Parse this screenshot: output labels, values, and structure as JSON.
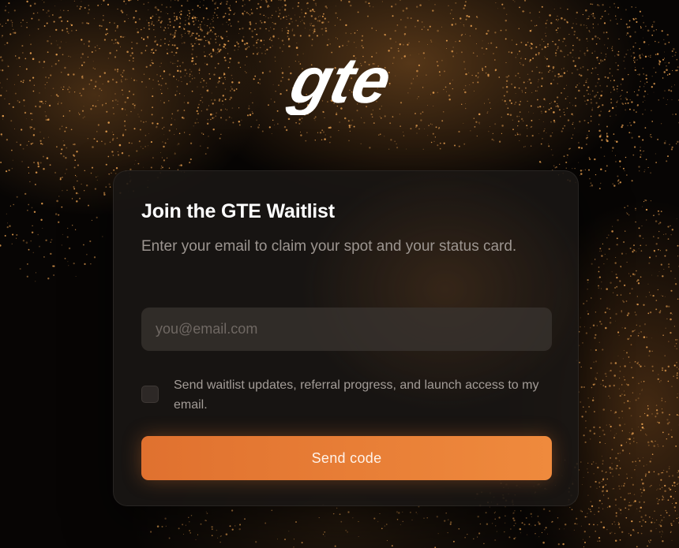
{
  "brand": {
    "logo_text": "gte"
  },
  "waitlist_card": {
    "title": "Join the GTE Waitlist",
    "subtitle": "Enter your email to claim your spot and your status card.",
    "email_field": {
      "placeholder": "you@email.com",
      "value": ""
    },
    "consent": {
      "checked": false,
      "label": "Send waitlist updates, referral progress, and launch access to my email."
    },
    "submit_label": "Send code"
  },
  "colors": {
    "accent": "#e8793a",
    "card_background": "#1a1614",
    "page_background": "#070504",
    "city_lights": "#e8a050"
  }
}
